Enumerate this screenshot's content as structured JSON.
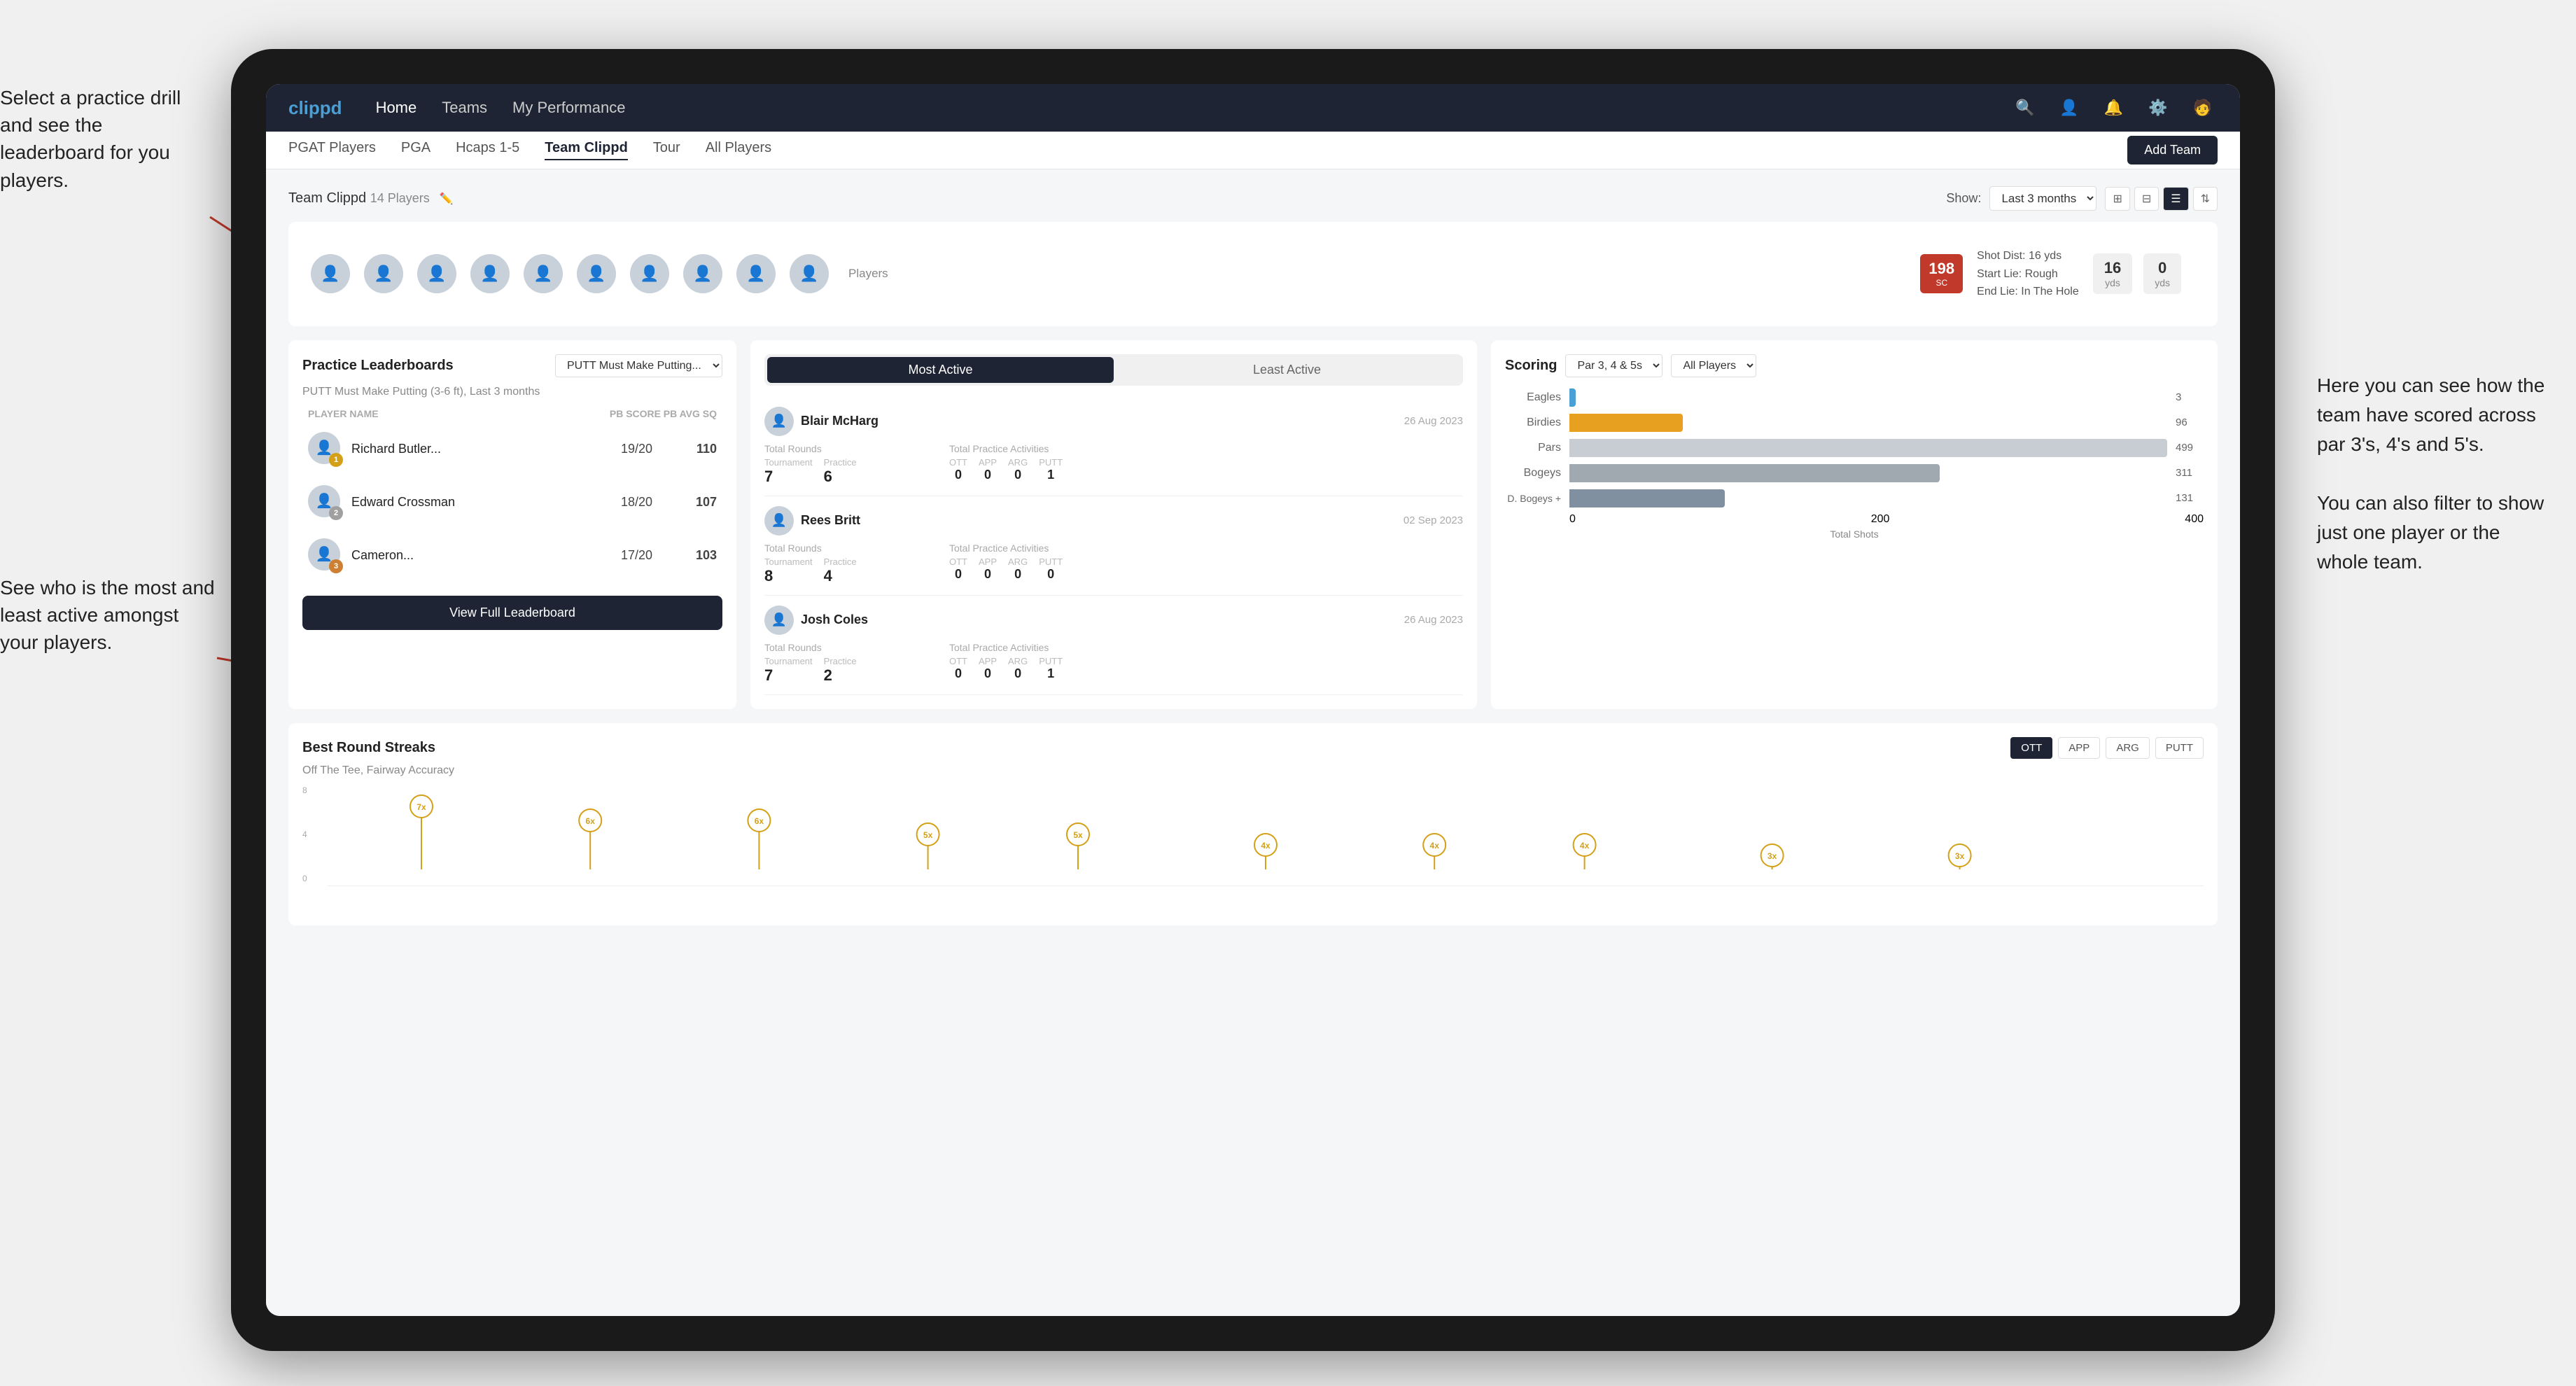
{
  "annotations": {
    "left_top": "Select a practice drill and see the leaderboard for you players.",
    "left_bottom": "See who is the most and least active amongst your players.",
    "right": "Here you can see how the team have scored across par 3's, 4's and 5's.\n\nYou can also filter to show just one player or the whole team."
  },
  "nav": {
    "logo": "clippd",
    "links": [
      "Home",
      "Teams",
      "My Performance"
    ],
    "icons": [
      "search",
      "person",
      "bell",
      "settings",
      "avatar"
    ]
  },
  "subnav": {
    "links": [
      "PGAT Players",
      "PGA",
      "Hcaps 1-5",
      "Team Clippd",
      "Tour",
      "All Players"
    ],
    "active": "Team Clippd",
    "add_team_label": "Add Team"
  },
  "team_header": {
    "title": "Team Clippd",
    "player_count": "14 Players",
    "show_label": "Show:",
    "show_value": "Last 3 months",
    "view_options": [
      "grid-sm",
      "grid-lg",
      "list",
      "sort"
    ]
  },
  "shot_info": {
    "badge": "198",
    "badge_sub": "SC",
    "detail1": "Shot Dist: 16 yds",
    "detail2": "Start Lie: Rough",
    "detail3": "End Lie: In The Hole",
    "yardage1": "16",
    "yardage1_label": "yds",
    "yardage2": "0",
    "yardage2_label": "yds"
  },
  "practice_leaderboard": {
    "title": "Practice Leaderboards",
    "drill_name": "PUTT Must Make Putting...",
    "subtitle": "PUTT Must Make Putting (3-6 ft), Last 3 months",
    "headers": {
      "player": "PLAYER NAME",
      "score": "PB SCORE",
      "avg": "PB AVG SQ"
    },
    "players": [
      {
        "rank": 1,
        "medal": "gold",
        "name": "Richard Butler...",
        "score": "19/20",
        "avg": "110"
      },
      {
        "rank": 2,
        "medal": "silver",
        "name": "Edward Crossman",
        "score": "18/20",
        "avg": "107"
      },
      {
        "rank": 3,
        "medal": "bronze",
        "name": "Cameron...",
        "score": "17/20",
        "avg": "103"
      }
    ],
    "view_full_label": "View Full Leaderboard"
  },
  "active_players": {
    "tabs": [
      "Most Active",
      "Least Active"
    ],
    "active_tab": "Most Active",
    "players": [
      {
        "name": "Blair McHarg",
        "date": "26 Aug 2023",
        "total_rounds_label": "Total Rounds",
        "tournament_label": "Tournament",
        "practice_label": "Practice",
        "tournament_val": "7",
        "practice_val": "6",
        "total_practice_label": "Total Practice Activities",
        "ott": "0",
        "app": "0",
        "arg": "0",
        "putt": "1"
      },
      {
        "name": "Rees Britt",
        "date": "02 Sep 2023",
        "total_rounds_label": "Total Rounds",
        "tournament_label": "Tournament",
        "practice_label": "Practice",
        "tournament_val": "8",
        "practice_val": "4",
        "total_practice_label": "Total Practice Activities",
        "ott": "0",
        "app": "0",
        "arg": "0",
        "putt": "0"
      },
      {
        "name": "Josh Coles",
        "date": "26 Aug 2023",
        "total_rounds_label": "Total Rounds",
        "tournament_label": "Tournament",
        "practice_label": "Practice",
        "tournament_val": "7",
        "practice_val": "2",
        "total_practice_label": "Total Practice Activities",
        "ott": "0",
        "app": "0",
        "arg": "0",
        "putt": "1"
      }
    ]
  },
  "scoring": {
    "title": "Scoring",
    "filter": "Par 3, 4 & 5s",
    "player_filter": "All Players",
    "bars": [
      {
        "label": "Eagles",
        "value": 3,
        "max": 499,
        "color": "#4a9fd4"
      },
      {
        "label": "Birdies",
        "value": 96,
        "max": 499,
        "color": "#e8a020"
      },
      {
        "label": "Pars",
        "value": 499,
        "max": 499,
        "color": "#c8cdd4"
      },
      {
        "label": "Bogeys",
        "value": 311,
        "max": 499,
        "color": "#a0a8b0"
      },
      {
        "label": "D. Bogeys +",
        "value": 131,
        "max": 499,
        "color": "#8090a0"
      }
    ],
    "x_labels": [
      "0",
      "200",
      "400"
    ],
    "x_title": "Total Shots"
  },
  "best_round_streaks": {
    "title": "Best Round Streaks",
    "subtitle": "Off The Tee, Fairway Accuracy",
    "filter_buttons": [
      "OTT",
      "APP",
      "ARG",
      "PUTT"
    ],
    "active_filter": "OTT",
    "dots": [
      {
        "label": "7x",
        "pos_pct": 5,
        "stem": 80
      },
      {
        "label": "6x",
        "pos_pct": 14,
        "stem": 60
      },
      {
        "label": "6x",
        "pos_pct": 22,
        "stem": 60
      },
      {
        "label": "5x",
        "pos_pct": 31,
        "stem": 40
      },
      {
        "label": "5x",
        "pos_pct": 38,
        "stem": 40
      },
      {
        "label": "4x",
        "pos_pct": 47,
        "stem": 30
      },
      {
        "label": "4x",
        "pos_pct": 55,
        "stem": 30
      },
      {
        "label": "4x",
        "pos_pct": 62,
        "stem": 30
      },
      {
        "label": "3x",
        "pos_pct": 71,
        "stem": 20
      },
      {
        "label": "3x",
        "pos_pct": 79,
        "stem": 20
      }
    ]
  },
  "players_avatars": [
    "👤",
    "👤",
    "👤",
    "👤",
    "👤",
    "👤",
    "👤",
    "👤",
    "👤",
    "👤"
  ]
}
